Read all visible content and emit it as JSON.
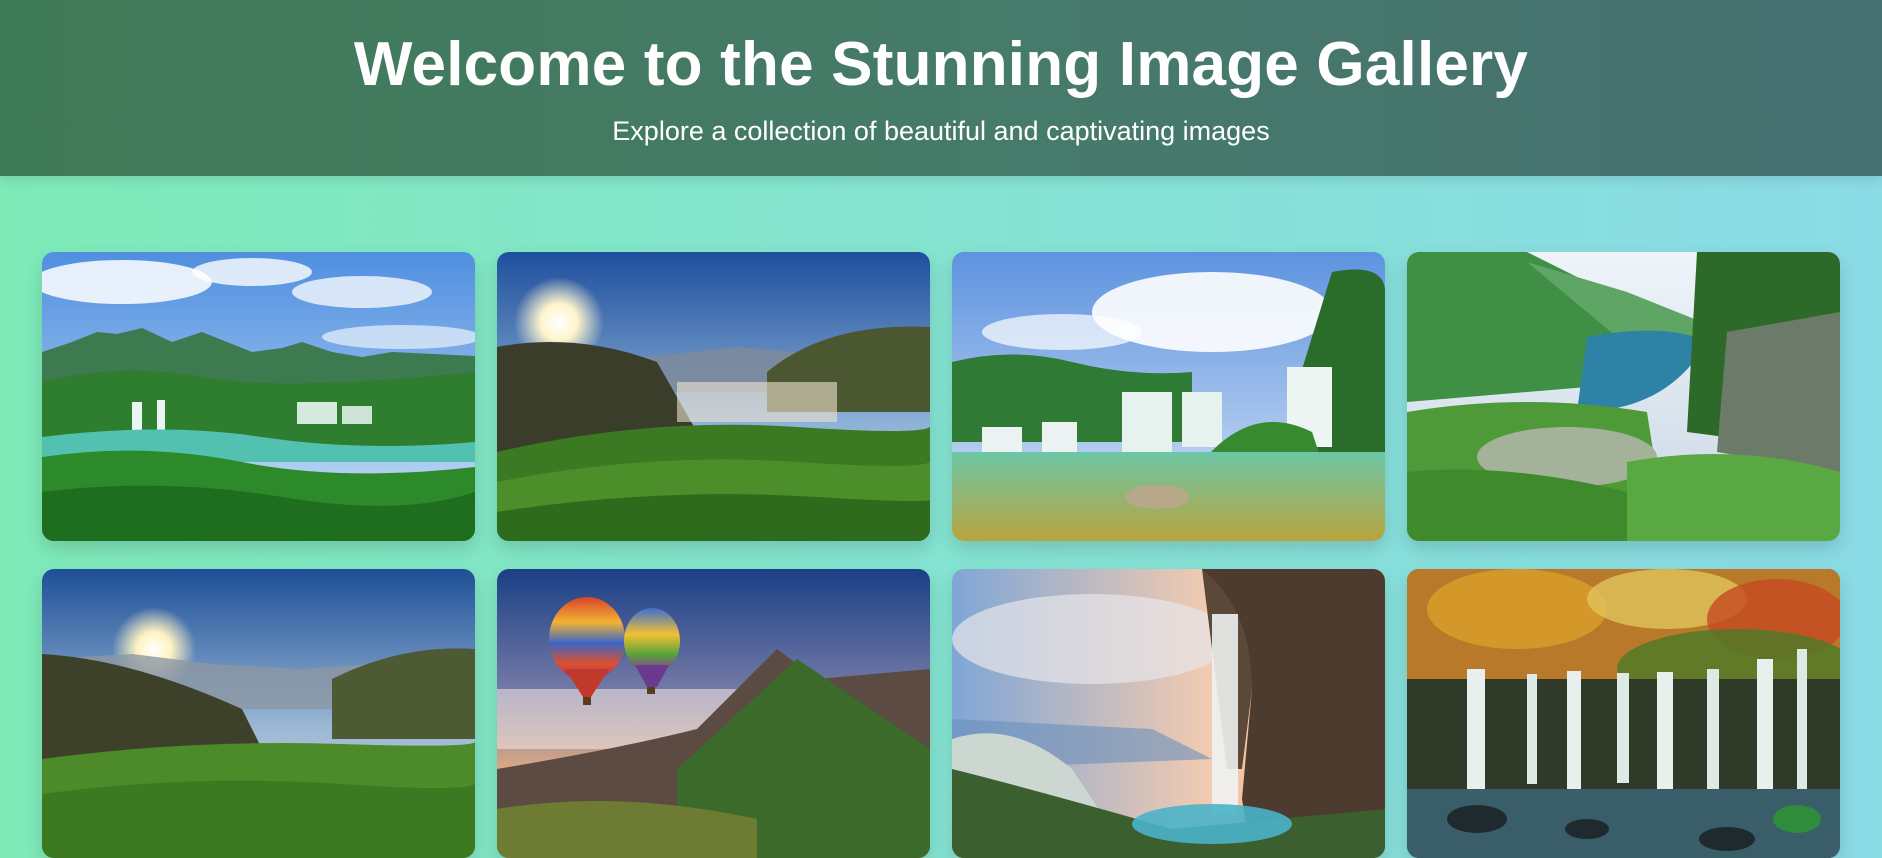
{
  "header": {
    "title": "Welcome to the Stunning Image Gallery",
    "subtitle": "Explore a collection of beautiful and captivating images"
  },
  "gallery": {
    "images": [
      {
        "icon": "waterfall-lagoon-image"
      },
      {
        "icon": "sunrise-tea-hills-image"
      },
      {
        "icon": "tropical-waterfall-image"
      },
      {
        "icon": "mountain-lake-image"
      },
      {
        "icon": "sunlit-tea-plantation-image"
      },
      {
        "icon": "hot-air-balloons-image"
      },
      {
        "icon": "cave-waterfall-image"
      },
      {
        "icon": "autumn-waterfall-image"
      }
    ]
  },
  "colors": {
    "header_bg": "#437a60",
    "page_bg_left": "#7eeab8",
    "page_bg_right": "#8adbe6"
  }
}
